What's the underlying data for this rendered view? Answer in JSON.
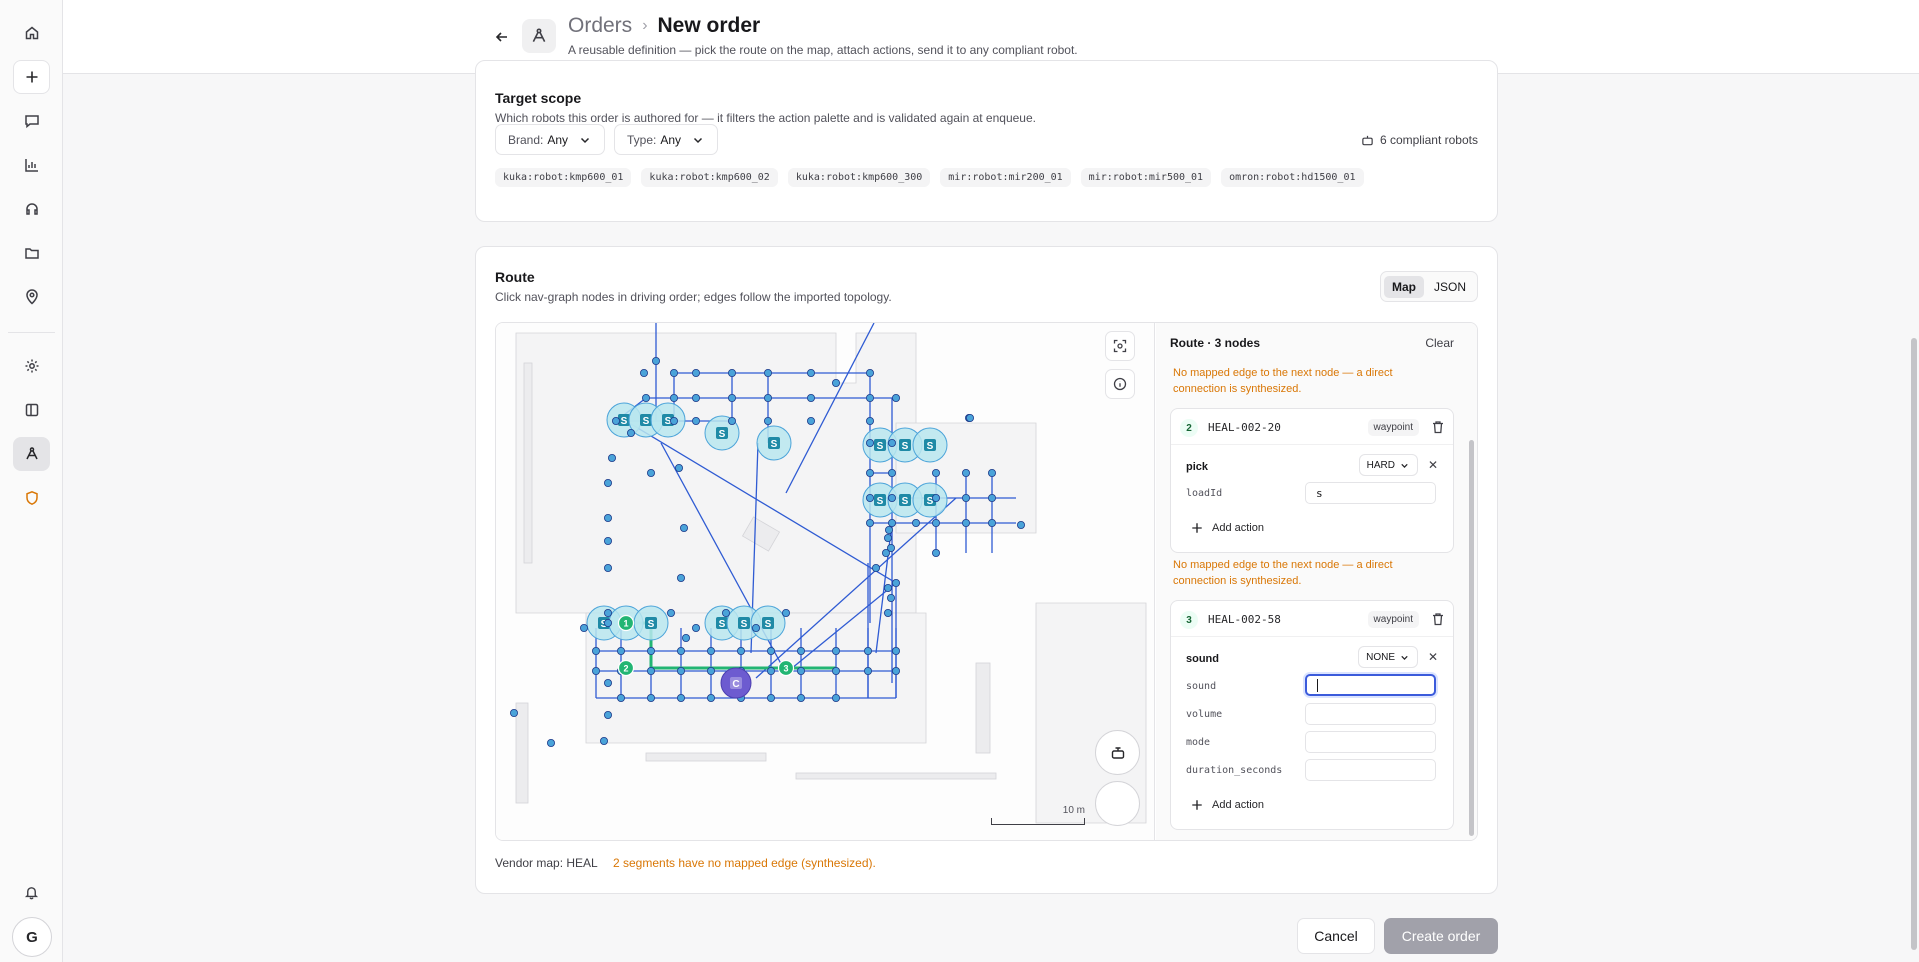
{
  "header": {
    "breadcrumb_parent": "Orders",
    "breadcrumb_current": "New order",
    "subtitle": "A reusable definition — pick the route on the map, attach actions, send it to any compliant robot."
  },
  "nav": {
    "icons": [
      "home-icon",
      "plus-icon",
      "chat-icon",
      "chart-icon",
      "headset-icon",
      "folder-icon",
      "location-icon",
      "gear-icon",
      "book-icon",
      "route-icon",
      "shield-icon",
      "bell-icon"
    ],
    "avatar_initial": "G"
  },
  "target_scope": {
    "title": "Target scope",
    "subtitle": "Which robots this order is authored for — it filters the action palette and is validated again at enqueue.",
    "brand_label": "Brand:",
    "brand_value": "Any",
    "type_label": "Type:",
    "type_value": "Any",
    "compliant": "6 compliant robots",
    "robots": [
      "kuka:robot:kmp600_01",
      "kuka:robot:kmp600_02",
      "kuka:robot:kmp600_300",
      "mir:robot:mir200_01",
      "mir:robot:mir500_01",
      "omron:robot:hd1500_01"
    ]
  },
  "route": {
    "title": "Route",
    "subtitle": "Click nav-graph nodes in driving order; edges follow the imported topology.",
    "tabs": [
      "Map",
      "JSON"
    ],
    "active_tab": "Map",
    "scale_label": "10 m",
    "station_glyph": "S",
    "charger_glyph": "C",
    "route_markers": [
      "1",
      "2",
      "3"
    ],
    "vendor_map": "Vendor map: HEAL",
    "synth_note": "2 segments have no mapped edge (synthesized).",
    "panel": {
      "title": "Route · 3 nodes",
      "clear": "Clear",
      "warning": "No mapped edge to the next node — a direct connection is synthesized.",
      "nodes": [
        {
          "num": "2",
          "id": "HEAL-002-20",
          "tag": "waypoint",
          "action": "pick",
          "blocking": "HARD",
          "params": [
            {
              "label": "loadId",
              "value": "s"
            }
          ]
        },
        {
          "num": "3",
          "id": "HEAL-002-58",
          "tag": "waypoint",
          "action": "sound",
          "blocking": "NONE",
          "params": [
            {
              "label": "sound",
              "value": ""
            },
            {
              "label": "volume",
              "value": ""
            },
            {
              "label": "mode",
              "value": ""
            },
            {
              "label": "duration_seconds",
              "value": ""
            }
          ]
        }
      ],
      "add_action": "Add action"
    }
  },
  "footer": {
    "cancel": "Cancel",
    "create": "Create order"
  },
  "colors": {
    "accent": "#3b5bdb",
    "edge": "#2f5bd3",
    "node": "#4aa3d9",
    "route_green": "#22b573",
    "warning": "#d97706"
  }
}
